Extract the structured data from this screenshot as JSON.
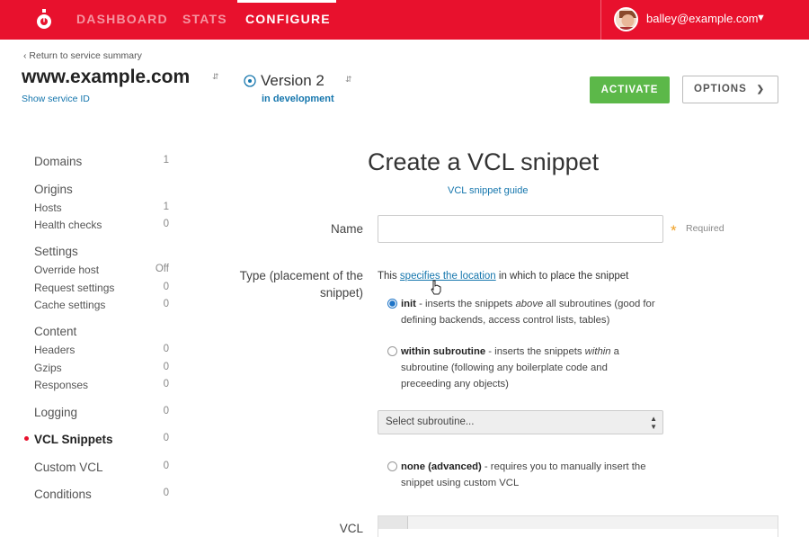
{
  "topnav": {
    "items": [
      "DASHBOARD",
      "STATS",
      "CONFIGURE"
    ],
    "active": "CONFIGURE",
    "user_email": "balley@example.com"
  },
  "header": {
    "back_link": "Return to service summary",
    "service_name": "www.example.com",
    "show_service_id": "Show service ID",
    "version_label": "Version 2",
    "version_status": "in development",
    "activate_label": "ACTIVATE",
    "options_label": "OPTIONS"
  },
  "sidebar": {
    "domains": {
      "label": "Domains",
      "count": "1"
    },
    "origins": {
      "label": "Origins",
      "hosts": {
        "label": "Hosts",
        "count": "1"
      },
      "health_checks": {
        "label": "Health checks",
        "count": "0"
      }
    },
    "settings": {
      "label": "Settings",
      "override_host": {
        "label": "Override host",
        "count": "Off"
      },
      "request_settings": {
        "label": "Request settings",
        "count": "0"
      },
      "cache_settings": {
        "label": "Cache settings",
        "count": "0"
      }
    },
    "content": {
      "label": "Content",
      "headers": {
        "label": "Headers",
        "count": "0"
      },
      "gzips": {
        "label": "Gzips",
        "count": "0"
      },
      "responses": {
        "label": "Responses",
        "count": "0"
      }
    },
    "logging": {
      "label": "Logging",
      "count": "0"
    },
    "vcl_snippets": {
      "label": "VCL Snippets",
      "count": "0"
    },
    "custom_vcl": {
      "label": "Custom VCL",
      "count": "0"
    },
    "conditions": {
      "label": "Conditions",
      "count": "0"
    }
  },
  "form": {
    "title": "Create a VCL snippet",
    "guide_link": "VCL snippet guide",
    "name_label": "Name",
    "name_value": "",
    "required_label": "Required",
    "type_label_line1": "Type (placement of the",
    "type_label_line2": "snippet)",
    "type_desc_prefix": "This ",
    "type_desc_link": "specifies the location",
    "type_desc_suffix": " in which to place the snippet",
    "options": {
      "init": {
        "title": "init",
        "text_before": " - inserts the snippets ",
        "em": "above",
        "text_after": " all subroutines (good for defining backends, access control lists, tables)",
        "checked": true
      },
      "within": {
        "title": "within subroutine",
        "text_before": " - inserts the snippets ",
        "em": "within",
        "text_after": " a subroutine (following any boilerplate code and preceeding any objects)",
        "checked": false
      },
      "none": {
        "title": "none (advanced)",
        "text": " - requires you to manually insert the snippet using custom VCL",
        "checked": false
      }
    },
    "subroutine_select": "Select subroutine...",
    "vcl_label": "VCL"
  },
  "colors": {
    "brand": "#e8112d",
    "activate": "#5cb849",
    "link": "#1576ad",
    "required_star": "#f0a023"
  }
}
